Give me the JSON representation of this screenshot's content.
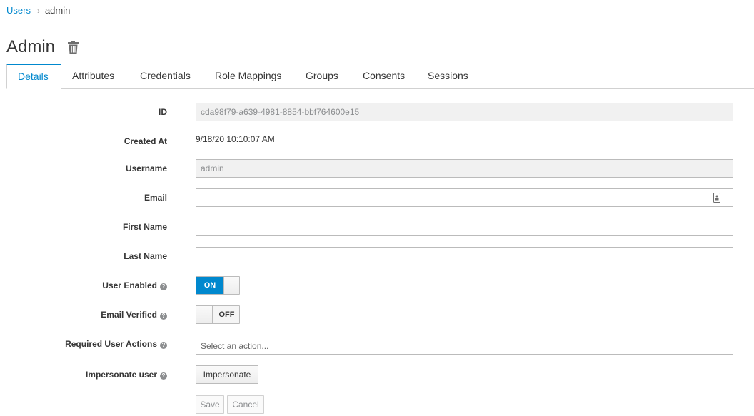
{
  "breadcrumb": {
    "parent": "Users",
    "separator": "›",
    "current": "admin"
  },
  "page": {
    "title": "Admin"
  },
  "tabs": [
    {
      "label": "Details",
      "active": true
    },
    {
      "label": "Attributes"
    },
    {
      "label": "Credentials"
    },
    {
      "label": "Role Mappings"
    },
    {
      "label": "Groups"
    },
    {
      "label": "Consents"
    },
    {
      "label": "Sessions"
    }
  ],
  "form": {
    "id": {
      "label": "ID",
      "value": "cda98f79-a639-4981-8854-bbf764600e15"
    },
    "created_at": {
      "label": "Created At",
      "value": "9/18/20 10:10:07 AM"
    },
    "username": {
      "label": "Username",
      "value": "admin"
    },
    "email": {
      "label": "Email",
      "value": ""
    },
    "first_name": {
      "label": "First Name",
      "value": ""
    },
    "last_name": {
      "label": "Last Name",
      "value": ""
    },
    "user_enabled": {
      "label": "User Enabled",
      "state": "ON"
    },
    "email_verified": {
      "label": "Email Verified",
      "state": "OFF"
    },
    "required_actions": {
      "label": "Required User Actions",
      "placeholder": "Select an action..."
    },
    "impersonate": {
      "label": "Impersonate user",
      "button": "Impersonate"
    },
    "help_glyph": "?"
  },
  "actions": {
    "save": "Save",
    "cancel": "Cancel"
  },
  "colors": {
    "accent": "#0088ce",
    "text": "#363636",
    "muted": "#8b8d8f",
    "border": "#bbbbbb"
  }
}
